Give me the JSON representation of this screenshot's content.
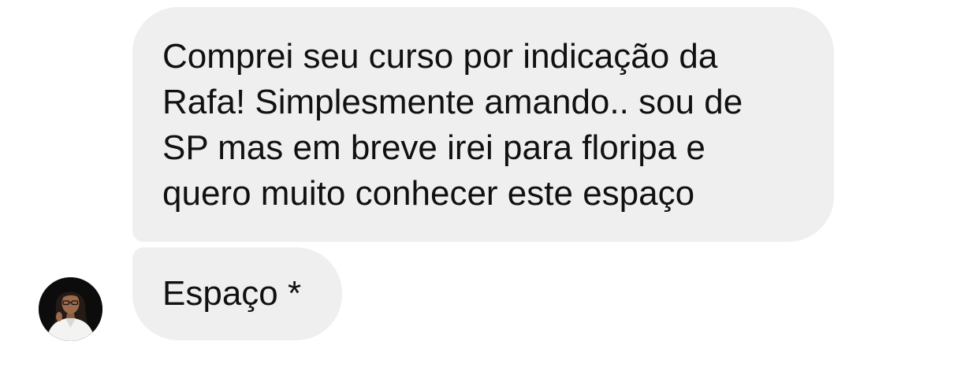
{
  "conversation": {
    "messages": [
      {
        "lines": [
          "Comprei seu curso por indicação da",
          "Rafa! Simplesmente amando.. sou de",
          "SP mas em breve irei para floripa e",
          "quero muito conhecer este espaço"
        ]
      },
      {
        "text": "Espaço *"
      }
    ],
    "avatar_icon": "profile-photo-avatar"
  },
  "colors": {
    "bubble_background": "#efefef",
    "text": "#111111",
    "page_background": "#ffffff"
  }
}
